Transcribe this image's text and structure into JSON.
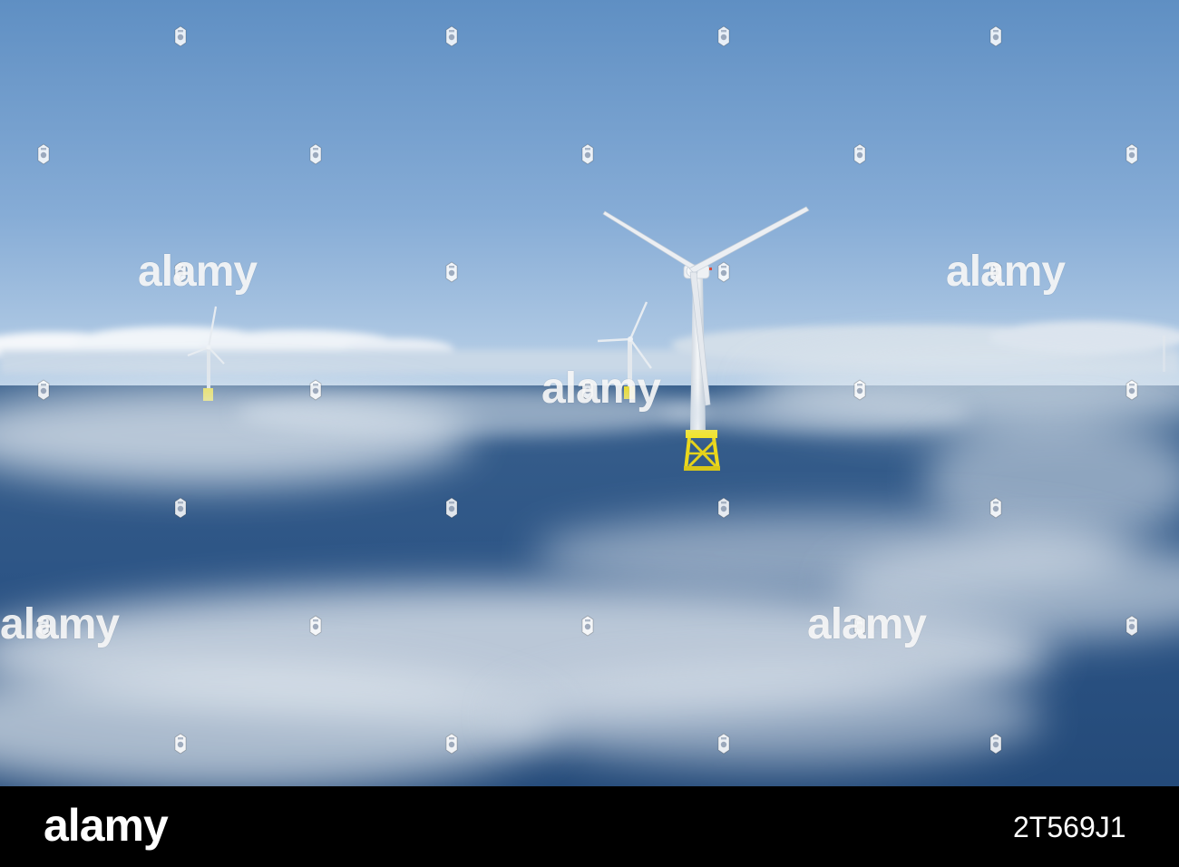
{
  "image": {
    "subject": "offshore wind turbines in sea fog",
    "colors": {
      "sky_top": "#6b98c8",
      "sky_horizon": "#b4cde6",
      "sea": "#2f5b8b",
      "sea_deep": "#1c3f6a",
      "fog": "#e4ebf2",
      "turbine": "#eef1f4",
      "foundation": "#f2e21c",
      "footer_bg": "#000000"
    },
    "icon_names": [
      "camera-watermark-icon"
    ]
  },
  "watermark": {
    "brand": "alamy"
  },
  "footer": {
    "logo": "alamy",
    "image_id": "2T569J1"
  }
}
